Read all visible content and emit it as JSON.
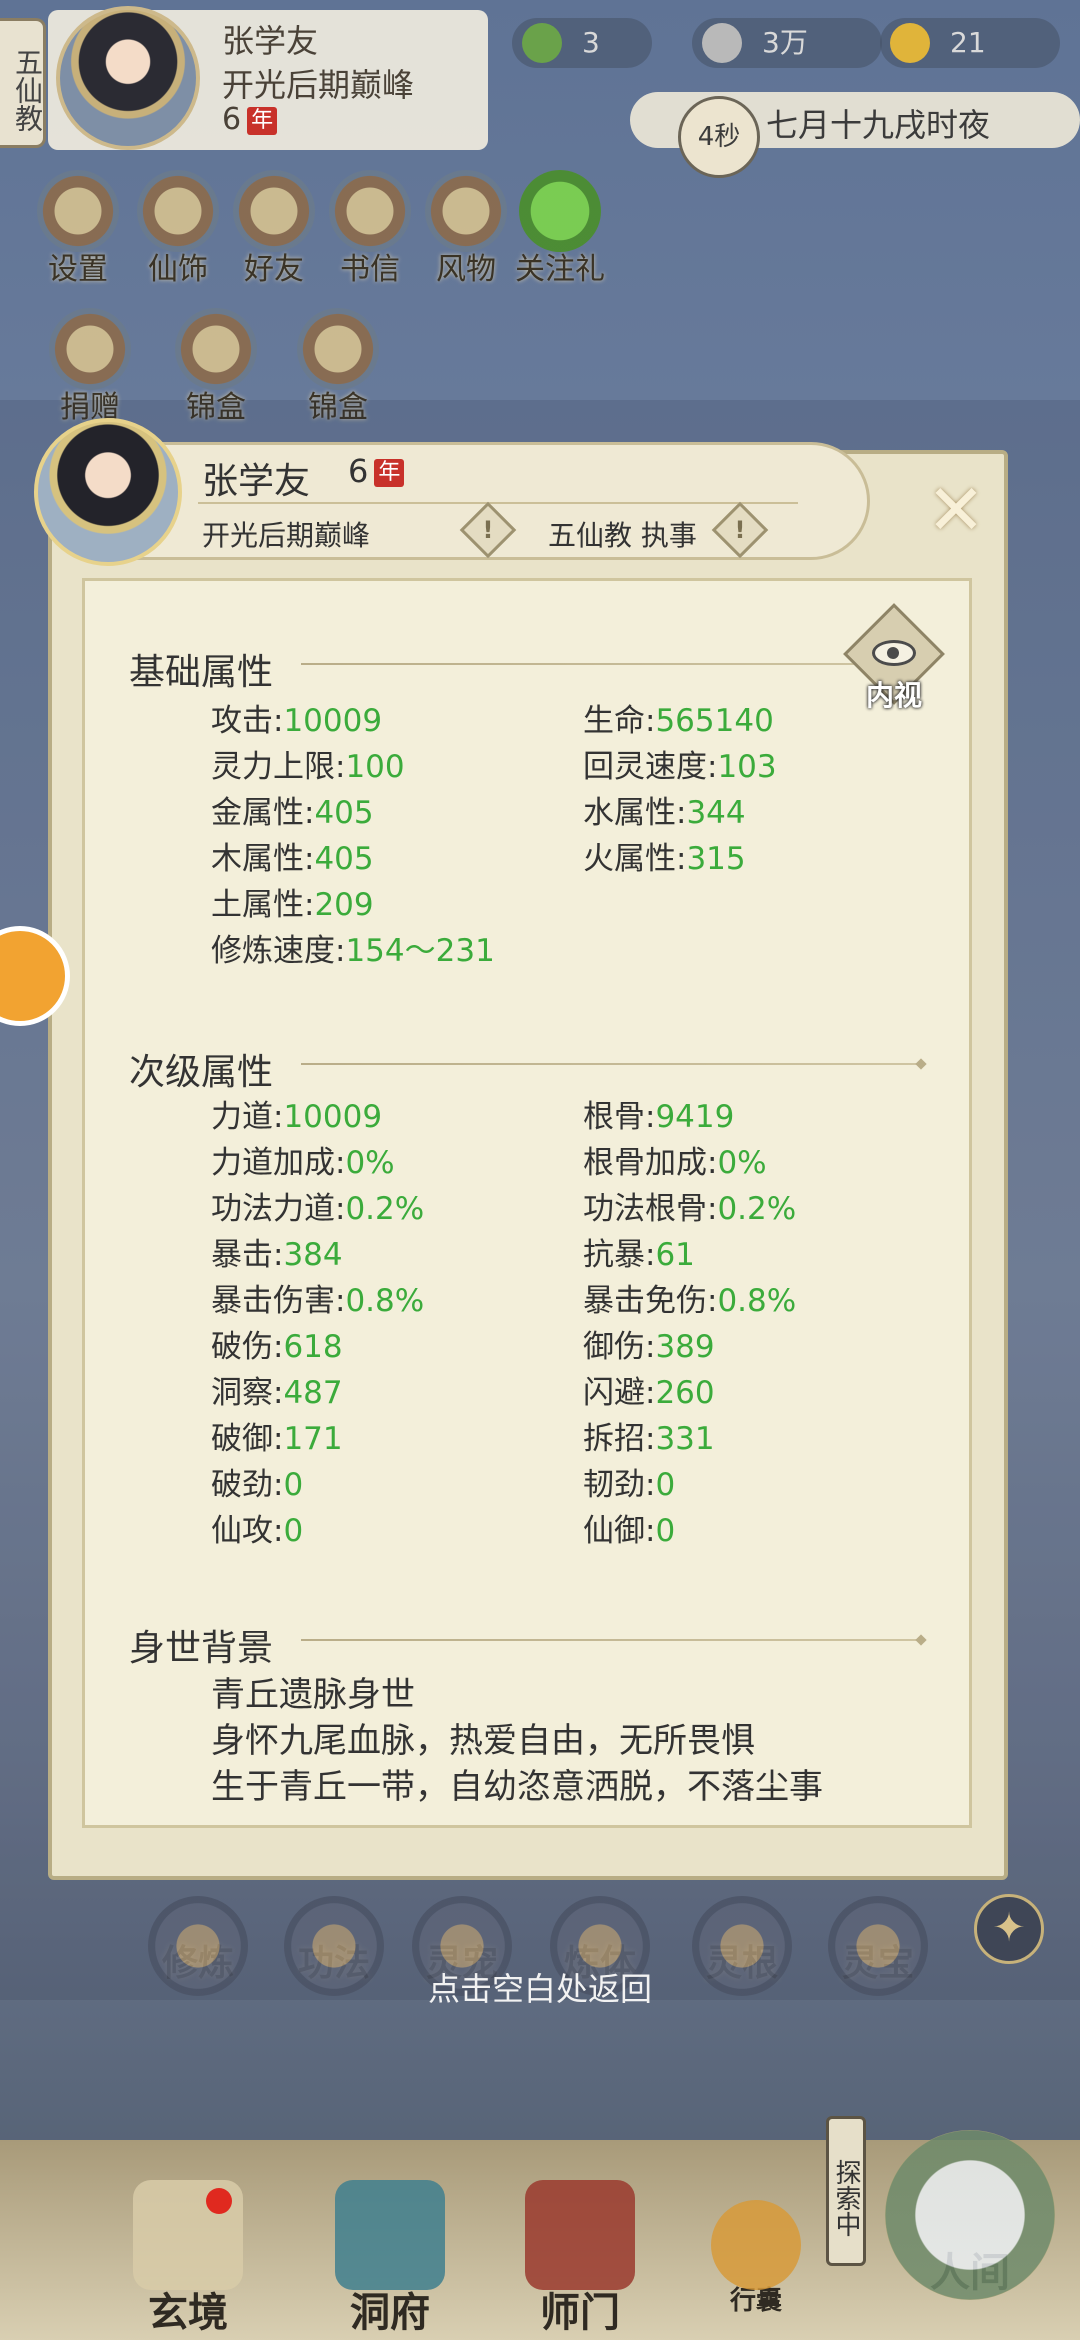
{
  "player": {
    "sect_tag": "五仙教",
    "name": "张学友",
    "realm": "开光后期巅峰",
    "age": "6",
    "age_unit": "年"
  },
  "resources": [
    {
      "icon": "jade-leaf-icon",
      "value": "3"
    },
    {
      "icon": "coin-icon",
      "value": "3万"
    },
    {
      "icon": "strength-icon",
      "value": "21"
    }
  ],
  "time": {
    "countdown": "4秒",
    "label": "七月十九戌时夜"
  },
  "features": [
    "设置",
    "仙饰",
    "好友",
    "书信",
    "风物",
    "关注礼"
  ],
  "events": [
    "捐赠",
    "锦盒",
    "锦盒"
  ],
  "panel": {
    "name": "张学友",
    "age": "6",
    "age_unit": "年",
    "realm": "开光后期巅峰",
    "sect": "五仙教 执事",
    "inner_view_label": "内视",
    "basic_title": "基础属性",
    "basic_stats": [
      {
        "label": "攻击",
        "value": "10009"
      },
      {
        "label": "生命",
        "value": "565140"
      },
      {
        "label": "灵力上限",
        "value": "100"
      },
      {
        "label": "回灵速度",
        "value": "103"
      },
      {
        "label": "金属性",
        "value": "405"
      },
      {
        "label": "水属性",
        "value": "344"
      },
      {
        "label": "木属性",
        "value": "405"
      },
      {
        "label": "火属性",
        "value": "315"
      },
      {
        "label": "土属性",
        "value": "209"
      },
      {
        "label": "修炼速度",
        "value": "154～231"
      }
    ],
    "secondary_title": "次级属性",
    "secondary_stats": [
      {
        "label": "力道",
        "value": "10009"
      },
      {
        "label": "根骨",
        "value": "9419"
      },
      {
        "label": "力道加成",
        "value": "0%"
      },
      {
        "label": "根骨加成",
        "value": "0%"
      },
      {
        "label": "功法力道",
        "value": "0.2%"
      },
      {
        "label": "功法根骨",
        "value": "0.2%"
      },
      {
        "label": "暴击",
        "value": "384"
      },
      {
        "label": "抗暴",
        "value": "61"
      },
      {
        "label": "暴击伤害",
        "value": "0.8%"
      },
      {
        "label": "暴击免伤",
        "value": "0.8%"
      },
      {
        "label": "破伤",
        "value": "618"
      },
      {
        "label": "御伤",
        "value": "389"
      },
      {
        "label": "洞察",
        "value": "487"
      },
      {
        "label": "闪避",
        "value": "260"
      },
      {
        "label": "破御",
        "value": "171"
      },
      {
        "label": "拆招",
        "value": "331"
      },
      {
        "label": "破劲",
        "value": "0"
      },
      {
        "label": "韧劲",
        "value": "0"
      },
      {
        "label": "仙攻",
        "value": "0"
      },
      {
        "label": "仙御",
        "value": "0"
      }
    ],
    "background_title": "身世背景",
    "background_lines": [
      "青丘遗脉身世",
      "身怀九尾血脉，热爱自由，无所畏惧",
      "生于青丘一带，自幼恣意洒脱，不落尘事"
    ]
  },
  "skills": [
    "修炼",
    "功法",
    "灵宠",
    "炼体",
    "灵根",
    "灵宝"
  ],
  "tap_return": "点击空白处返回",
  "nav": [
    "玄境",
    "洞府",
    "师门",
    "行囊",
    "人间"
  ],
  "explore_tag": "探索中"
}
